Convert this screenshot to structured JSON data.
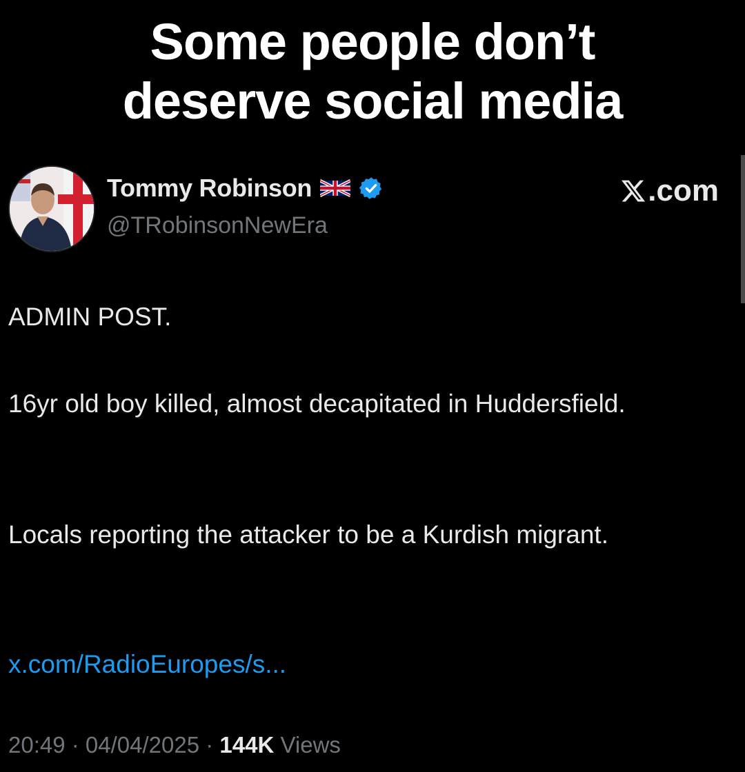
{
  "overlay_caption": {
    "line1": "Some people don’t",
    "line2": "deserve social media"
  },
  "post": {
    "author": {
      "display_name": "Tommy Robinson",
      "handle": "@TRobinsonNewEra",
      "flag_icon": "uk-flag-icon",
      "verified_icon": "verified-badge-icon",
      "verified_color": "#1d9bf0"
    },
    "source_label": ".com",
    "source_icon": "x-logo-icon",
    "paragraphs": [
      "ADMIN POST.",
      "16yr old boy killed, almost decapitated in Huddersfield.",
      "Locals reporting the attacker to be a Kurdish migrant."
    ],
    "link_text": "x.com/RadioEuropes/s...",
    "time": "20:49",
    "separator": " · ",
    "date": "04/04/2025",
    "views_count": "144K",
    "views_label": " Views"
  },
  "colors": {
    "background": "#000000",
    "text_primary": "#e7e9ea",
    "text_secondary": "#71767b",
    "link": "#1d9bf0"
  }
}
